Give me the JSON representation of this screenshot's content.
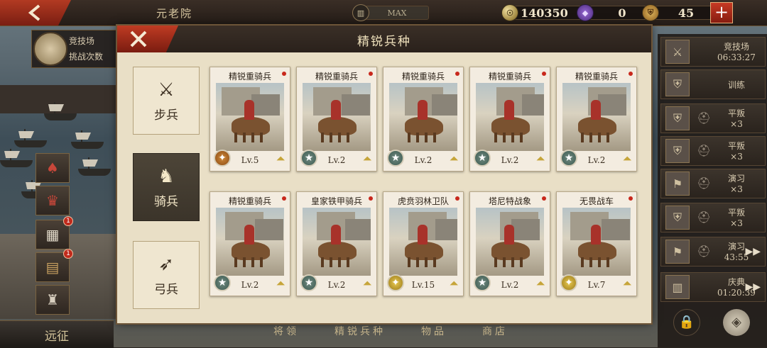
{
  "topbar": {
    "title": "元老院",
    "building_level": "MAX",
    "coins": "140350",
    "gems": "0",
    "third_resource": "45"
  },
  "left_panel": {
    "arena_title": "竞技场",
    "arena_sub": "挑战次数",
    "badge_counts": [
      "1",
      "1"
    ],
    "expedition": "远征"
  },
  "dialog": {
    "title": "精锐兵种",
    "categories": [
      {
        "label": "步兵"
      },
      {
        "label": "骑兵"
      },
      {
        "label": "弓兵"
      }
    ],
    "units": [
      {
        "name": "精锐重骑兵",
        "level": "Lv.5",
        "badge": "bronze"
      },
      {
        "name": "精锐重骑兵",
        "level": "Lv.2",
        "badge": "silver"
      },
      {
        "name": "精锐重骑兵",
        "level": "Lv.2",
        "badge": "silver"
      },
      {
        "name": "精锐重骑兵",
        "level": "Lv.2",
        "badge": "silver"
      },
      {
        "name": "精锐重骑兵",
        "level": "Lv.2",
        "badge": "silver"
      },
      {
        "name": "精锐重骑兵",
        "level": "Lv.2",
        "badge": "silver"
      },
      {
        "name": "皇家铁甲骑兵",
        "level": "Lv.2",
        "badge": "silver"
      },
      {
        "name": "虎贲羽林卫队",
        "level": "Lv.15",
        "badge": "gold"
      },
      {
        "name": "塔尼特战象",
        "level": "Lv.2",
        "badge": "silver"
      },
      {
        "name": "无畏战车",
        "level": "Lv.7",
        "badge": "gold"
      }
    ]
  },
  "bottom_tabs": [
    "将领",
    "精锐兵种",
    "物品",
    "商店"
  ],
  "queue": [
    {
      "line1": "竞技场",
      "line2": "06:33:27"
    },
    {
      "line1": "训练",
      "line2": ""
    },
    {
      "line1": "平叛",
      "line2": "×3"
    },
    {
      "line1": "平叛",
      "line2": "×3"
    },
    {
      "line1": "演习",
      "line2": "×3"
    },
    {
      "line1": "平叛",
      "line2": "×3"
    },
    {
      "line1": "演习",
      "line2": "43:55"
    },
    {
      "line1": "庆典",
      "line2": "01:20:39"
    }
  ]
}
